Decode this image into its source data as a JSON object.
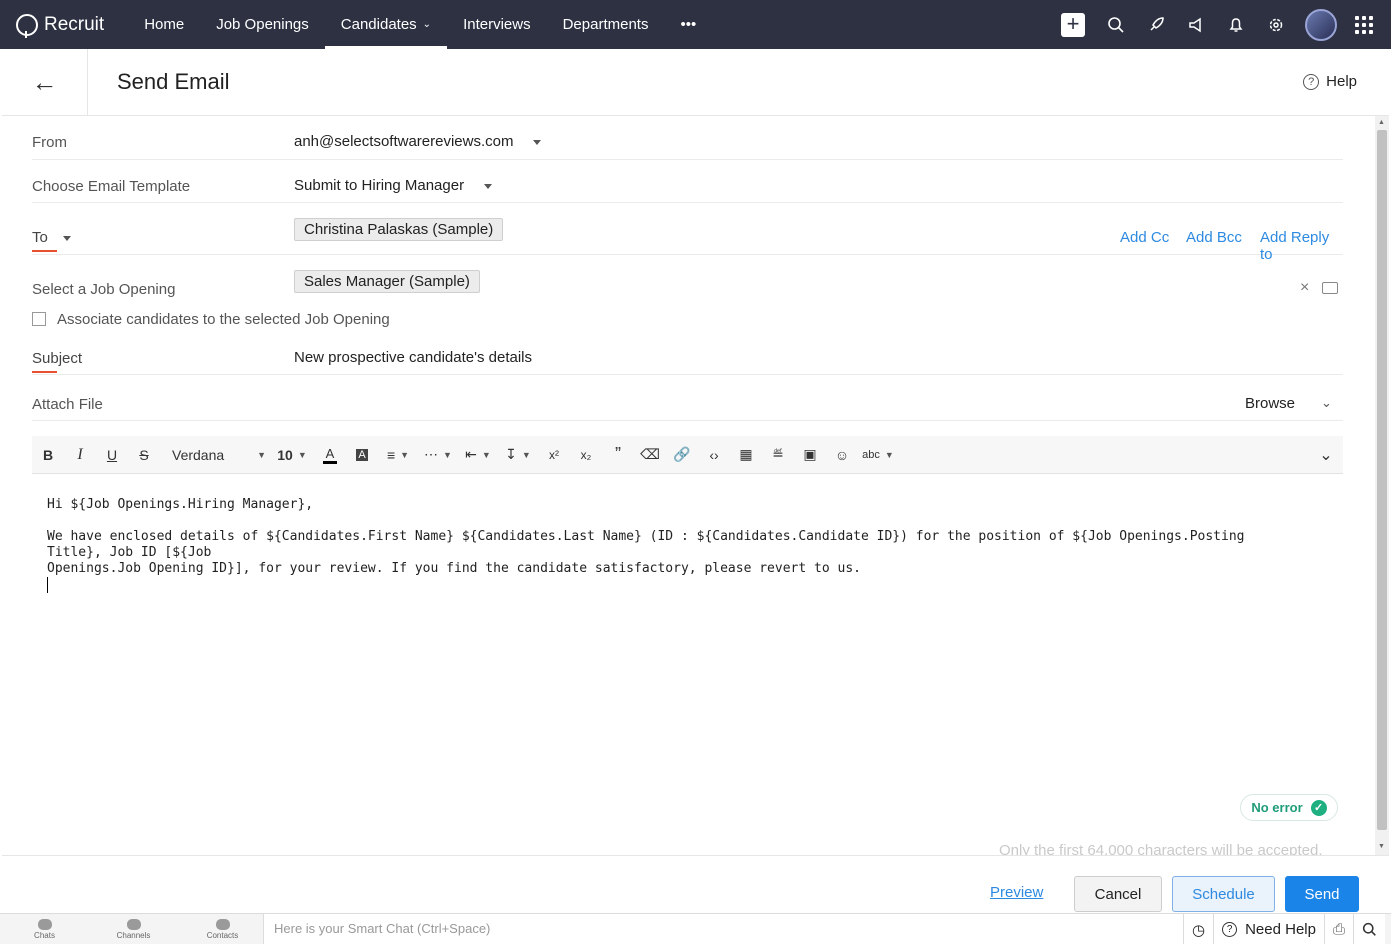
{
  "app": {
    "name": "Recruit"
  },
  "nav": {
    "items": [
      {
        "label": "Home"
      },
      {
        "label": "Job Openings"
      },
      {
        "label": "Candidates"
      },
      {
        "label": "Interviews"
      },
      {
        "label": "Departments"
      },
      {
        "label": "•••"
      }
    ],
    "active": "Candidates"
  },
  "header": {
    "title": "Send Email",
    "help": "Help"
  },
  "form": {
    "from_label": "From",
    "from_value": "anh@selectsoftwarereviews.com",
    "template_label": "Choose Email Template",
    "template_value": "Submit to Hiring Manager",
    "to_label": "To",
    "to_chip": "Christina Palaskas (Sample)",
    "add_cc": "Add Cc",
    "add_bcc": "Add Bcc",
    "add_reply_to": "Add Reply to",
    "job_label": "Select a Job Opening",
    "job_chip": "Sales Manager (Sample)",
    "associate_label": "Associate candidates to the selected Job Opening",
    "subject_label": "Subject",
    "subject_value": "New prospective candidate's details",
    "attach_label": "Attach File",
    "browse": "Browse"
  },
  "toolbar": {
    "font": "Verdana",
    "size": "10"
  },
  "editor": {
    "line1": "Hi ${Job Openings.Hiring Manager},",
    "line2": "We have enclosed details of ${Candidates.First Name} ${Candidates.Last Name} (ID : ${Candidates.Candidate ID}) for the position of ${Job Openings.Posting Title}, Job ID [${Job",
    "line3": "Openings.Job Opening ID}], for your review. If you find the candidate satisfactory, please revert to us."
  },
  "status": {
    "no_error": "No error",
    "limit_note": "Only the first 64,000 characters will be accepted."
  },
  "footer": {
    "preview": "Preview",
    "cancel": "Cancel",
    "schedule": "Schedule",
    "send": "Send"
  },
  "bottombar": {
    "chats": "Chats",
    "channels": "Channels",
    "contacts": "Contacts",
    "smart_chat": "Here is your Smart Chat (Ctrl+Space)",
    "need_help": "Need Help"
  },
  "colors": {
    "nav_bg": "#2d3142",
    "accent": "#1a84e8",
    "link": "#2d8ae0",
    "required": "#e8502f",
    "success": "#1fb082"
  },
  "icons": [
    "plus-icon",
    "search-icon",
    "rocket-icon",
    "megaphone-icon",
    "bell-icon",
    "gear-icon",
    "apps-grid-icon"
  ]
}
